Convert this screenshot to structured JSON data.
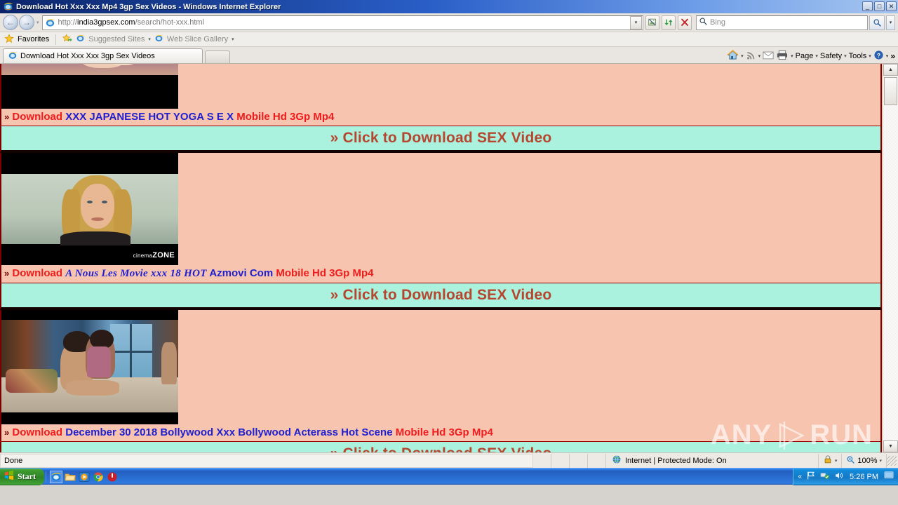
{
  "window": {
    "title": "Download Hot Xxx Xxx Mp4 3gp Sex Videos - Windows Internet Explorer",
    "minimize_label": "_",
    "maximize_label": "□",
    "close_label": "✕"
  },
  "nav": {
    "back_label": "←",
    "forward_label": "→",
    "history_caret": "▾",
    "url_scheme": "http://",
    "url_host": "india3gpsex.com",
    "url_path": "/search/hot-xxx.html",
    "url_full": "http://india3gpsex.com/search/hot-xxx.html",
    "address_dropdown": "▾",
    "compat_icon": "compatibility-view-icon",
    "refresh_icon": "refresh-icon",
    "stop_icon": "stop-icon",
    "search_placeholder": "Bing",
    "search_value": "",
    "search_go": "search-icon",
    "search_caret": "▾"
  },
  "favorites_bar": {
    "favorites_label": "Favorites",
    "add_to_favorites_icon": "add-favorites-icon",
    "suggested_sites_label": "Suggested Sites",
    "web_slice_label": "Web Slice Gallery",
    "caret": "▾"
  },
  "tabs": {
    "items": [
      {
        "label": "Download Hot Xxx Xxx 3gp Sex Videos",
        "title": "Download Hot Xxx Xxx Mp4 3gp Sex Videos"
      }
    ],
    "new_tab_label": ""
  },
  "command_bar": {
    "home_label": "home-icon",
    "feeds_label": "feeds-icon",
    "mail_label": "mail-icon",
    "print_label": "print-icon",
    "page_label": "Page",
    "safety_label": "Safety",
    "tools_label": "Tools",
    "help_label": "help-icon",
    "overflow_label": "»",
    "caret": "▾"
  },
  "page": {
    "background_color": "#f7c4b0",
    "cta_background_color": "#aaf2de",
    "cta_text_color": "#b6462f",
    "border_color": "#7d0000",
    "link_red": "#ee1c1c",
    "link_blue": "#2020cf",
    "cta_text": "» Click to Download SEX Video",
    "chevron": "»",
    "download_label": "Download",
    "suffix": "Mobile Hd 3Gp Mp4",
    "items": [
      {
        "download_label": "Download",
        "title": "XXX JAPANESE HOT YOGA S E X",
        "title_style": "normal",
        "suffix": "Mobile Hd 3Gp Mp4",
        "cta": "» Click to Download SEX Video",
        "thumb_watermark": ""
      },
      {
        "download_label": "Download",
        "title_fancy": "A Nous Les Movie xxx 18 HOT",
        "title": "Azmovi Com",
        "title_style": "fancy",
        "suffix": "Mobile Hd 3Gp Mp4",
        "cta": "» Click to Download SEX Video",
        "thumb_watermark_prefix": "cinema",
        "thumb_watermark_suffix": "ZONE"
      },
      {
        "download_label": "Download",
        "title": "December 30 2018 Bollywood Xxx Bollywood Acterass Hot Scene",
        "title_style": "normal",
        "suffix": "Mobile Hd 3Gp Mp4",
        "cta": "» Click to Download SEX Video",
        "thumb_watermark": ""
      }
    ],
    "overlay_watermark": {
      "left": "ANY",
      "right": "RUN"
    }
  },
  "scrollbar": {
    "up_arrow": "▲",
    "down_arrow": "▼"
  },
  "status_bar": {
    "status_text": "Done",
    "zone_icon": "globe-icon",
    "zone_text": "Internet | Protected Mode: On",
    "protected_caret": "▾",
    "zoom_level": "100%",
    "zoom_caret": "▾"
  },
  "taskbar": {
    "start_label": "Start",
    "quick_launch": [
      {
        "name": "internet-explorer-icon",
        "active": true
      },
      {
        "name": "windows-explorer-icon",
        "active": false
      },
      {
        "name": "media-player-icon",
        "active": false
      },
      {
        "name": "chrome-icon",
        "active": false
      },
      {
        "name": "shutdown-icon",
        "active": false
      }
    ],
    "tray": {
      "show_hidden": "«",
      "flag_icon": "flag-icon",
      "network_icon": "network-icon",
      "volume_icon": "volume-icon",
      "clock": "5:26 PM",
      "desktop_icon": "show-desktop-icon"
    }
  }
}
